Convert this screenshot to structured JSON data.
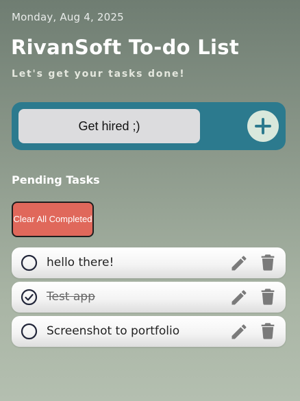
{
  "header": {
    "date": "Monday, Aug 4, 2025",
    "title": "RivanSoft To-do List",
    "subtitle": "Let's get your tasks done!"
  },
  "add_task": {
    "input_value": "Get hired ;)",
    "add_icon": "plus-icon"
  },
  "pending": {
    "title": "Pending Tasks",
    "clear_button": "Clear All Completed"
  },
  "tasks": [
    {
      "label": "hello there!",
      "completed": false
    },
    {
      "label": "Test app",
      "completed": true
    },
    {
      "label": "Screenshot to portfolio",
      "completed": false
    }
  ],
  "colors": {
    "accent": "#2c7a8e",
    "add_button_bg": "#d9e8dc",
    "clear_button": "#e0685b",
    "icon_gray": "#7a7a7a",
    "checkbox": "#22263a"
  }
}
